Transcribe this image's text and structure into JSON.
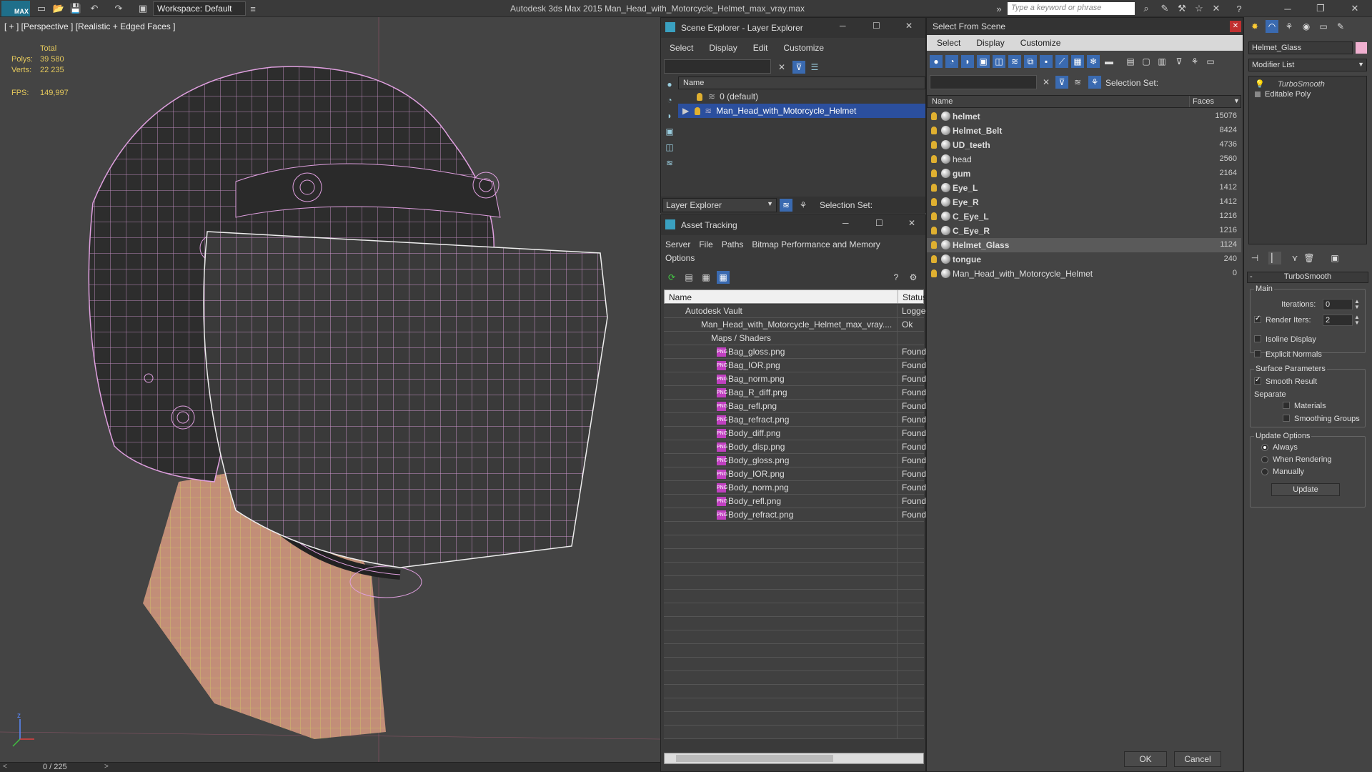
{
  "titlebar": {
    "logo": "MAX",
    "workspace": "Workspace: Default",
    "app_title": "Autodesk 3ds Max  2015    Man_Head_with_Motorcycle_Helmet_max_vray.max",
    "search_placeholder": "Type a keyword or phrase"
  },
  "viewport": {
    "label": "[ + ] [Perspective ] [Realistic + Edged Faces ]",
    "stats": {
      "total_label": "Total",
      "polys_label": "Polys:",
      "polys": "39 580",
      "verts_label": "Verts:",
      "verts": "22 235",
      "fps_label": "FPS:",
      "fps": "149,997"
    },
    "timeline": "0 / 225"
  },
  "scene_explorer": {
    "title": "Scene Explorer - Layer Explorer",
    "menu": [
      "Select",
      "Display",
      "Edit",
      "Customize"
    ],
    "col_name": "Name",
    "rows": [
      "0 (default)",
      "Man_Head_with_Motorcycle_Helmet"
    ],
    "footer_dropdown": "Layer Explorer",
    "selection_set": "Selection Set:"
  },
  "asset_tracking": {
    "title": "Asset Tracking",
    "menu": [
      "Server",
      "File",
      "Paths",
      "Bitmap Performance and Memory",
      "Options"
    ],
    "col_name": "Name",
    "col_status": "Status",
    "rows": [
      {
        "name": "Autodesk Vault",
        "status": "Logged"
      },
      {
        "name": "Man_Head_with_Motorcycle_Helmet_max_vray....",
        "status": "Ok"
      },
      {
        "name": "Maps / Shaders",
        "status": ""
      },
      {
        "name": "Bag_gloss.png",
        "status": "Found"
      },
      {
        "name": "Bag_IOR.png",
        "status": "Found"
      },
      {
        "name": "Bag_norm.png",
        "status": "Found"
      },
      {
        "name": "Bag_R_diff.png",
        "status": "Found"
      },
      {
        "name": "Bag_refl.png",
        "status": "Found"
      },
      {
        "name": "Bag_refract.png",
        "status": "Found"
      },
      {
        "name": "Body_diff.png",
        "status": "Found"
      },
      {
        "name": "Body_disp.png",
        "status": "Found"
      },
      {
        "name": "Body_gloss.png",
        "status": "Found"
      },
      {
        "name": "Body_IOR.png",
        "status": "Found"
      },
      {
        "name": "Body_norm.png",
        "status": "Found"
      },
      {
        "name": "Body_refl.png",
        "status": "Found"
      },
      {
        "name": "Body_refract.png",
        "status": "Found"
      }
    ]
  },
  "select_from_scene": {
    "title": "Select From Scene",
    "menu": [
      "Select",
      "Display",
      "Customize"
    ],
    "selection_set": "Selection Set:",
    "col_name": "Name",
    "col_faces": "Faces",
    "rows": [
      {
        "name": "helmet",
        "faces": "15076"
      },
      {
        "name": "Helmet_Belt",
        "faces": "8424"
      },
      {
        "name": "UD_teeth",
        "faces": "4736"
      },
      {
        "name": "head",
        "faces": "2560"
      },
      {
        "name": "gum",
        "faces": "2164"
      },
      {
        "name": "Eye_L",
        "faces": "1412"
      },
      {
        "name": "Eye_R",
        "faces": "1412"
      },
      {
        "name": "C_Eye_L",
        "faces": "1216"
      },
      {
        "name": "C_Eye_R",
        "faces": "1216"
      },
      {
        "name": "Helmet_Glass",
        "faces": "1124"
      },
      {
        "name": "tongue",
        "faces": "240"
      },
      {
        "name": "Man_Head_with_Motorcycle_Helmet",
        "faces": "0"
      }
    ],
    "ok": "OK",
    "cancel": "Cancel"
  },
  "command_panel": {
    "object_name": "Helmet_Glass",
    "modifier_list": "Modifier List",
    "stack": [
      "TurboSmooth",
      "Editable Poly"
    ],
    "rollout_title": "TurboSmooth",
    "main": "Main",
    "iterations_label": "Iterations:",
    "iterations": "0",
    "render_iters_label": "Render Iters:",
    "render_iters": "2",
    "isoline": "Isoline Display",
    "explicit_normals": "Explicit Normals",
    "surface_params": "Surface Parameters",
    "smooth_result": "Smooth Result",
    "separate": "Separate",
    "materials": "Materials",
    "smoothing_groups": "Smoothing Groups",
    "update_options": "Update Options",
    "always": "Always",
    "when_rendering": "When Rendering",
    "manually": "Manually",
    "update": "Update"
  },
  "colors": {
    "accent": "#2b4f9e",
    "wire_pink": "#e0a0e0",
    "wire_yellow": "#d8e060",
    "bulb": "#e0b030"
  }
}
